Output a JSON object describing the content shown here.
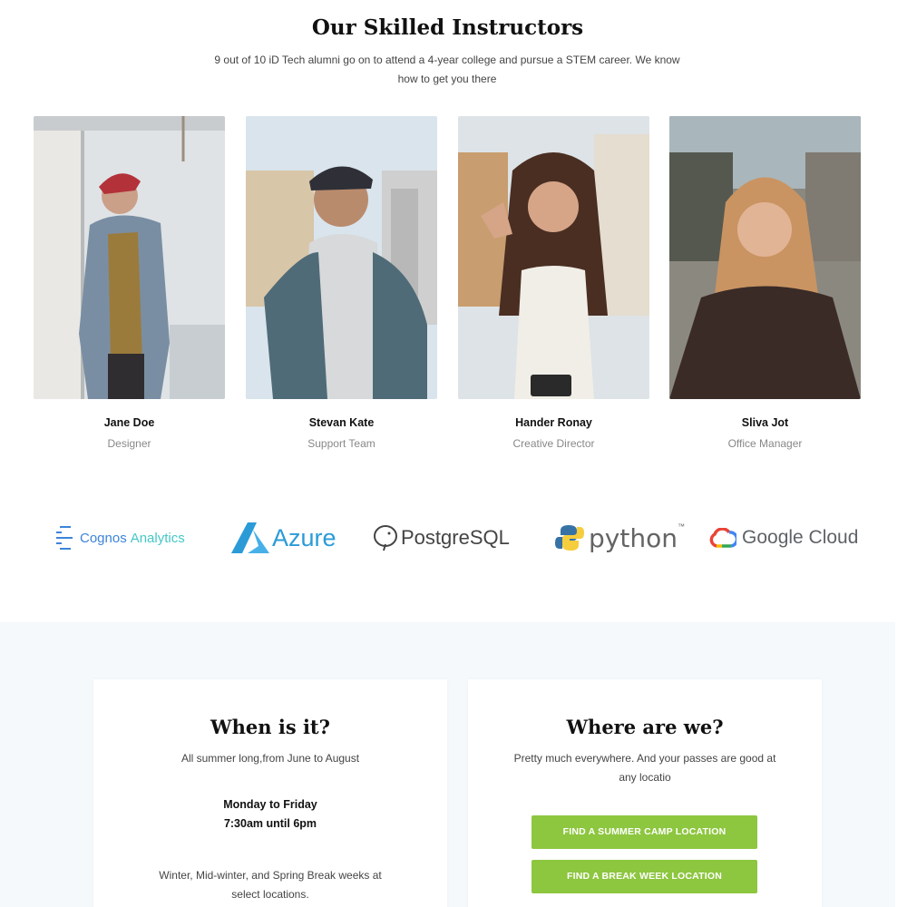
{
  "instructors": {
    "title": "Our Skilled Instructors",
    "subtitle": "9 out of 10 iD Tech alumni go on to attend a 4-year college and pursue a STEM career. We know how to get you there",
    "members": [
      {
        "name": "Jane Doe",
        "role": "Designer"
      },
      {
        "name": "Stevan Kate",
        "role": "Support Team"
      },
      {
        "name": "Hander Ronay",
        "role": "Creative Director"
      },
      {
        "name": "Sliva Jot",
        "role": "Office Manager"
      }
    ]
  },
  "partners": {
    "cognos": {
      "word1": "Cognos",
      "word2": "Analytics"
    },
    "azure": "Azure",
    "postgres": "PostgreSQL",
    "python": "python",
    "python_tm": "™",
    "gcloud": "Google Cloud"
  },
  "when": {
    "title": "When is it?",
    "text": "All summer long,from June to August",
    "days": "Monday to Friday",
    "time": "7:30am until 6pm",
    "note": "Winter, Mid-winter, and Spring Break weeks at select locations."
  },
  "where": {
    "title": "Where are we?",
    "text": "Pretty much everywhere. And your passes are good at any locatio",
    "button_summer": "FIND A SUMMER CAMP LOCATION",
    "button_break": "FIND A BREAK WEEK LOCATION"
  },
  "colors": {
    "accent_green": "#8dc63f",
    "cognos_blue": "#3d84d9",
    "azure_blue": "#2b9bd8",
    "python_blue": "#3772a4",
    "python_yellow": "#f6cd3c"
  }
}
